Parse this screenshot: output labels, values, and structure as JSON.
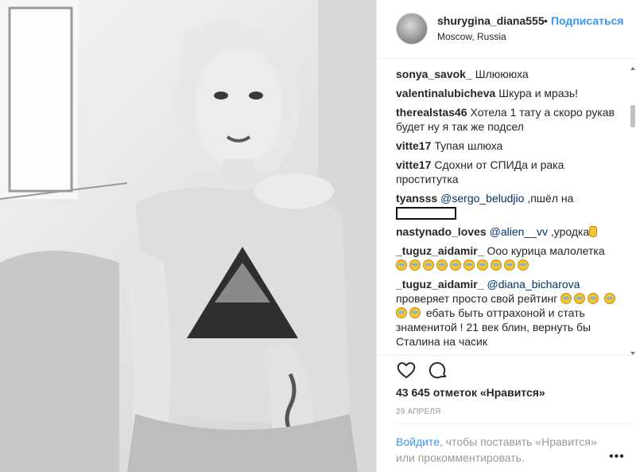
{
  "post": {
    "username": "shurygina_diana555",
    "separator": "•",
    "follow_label": "Подписаться",
    "location": "Moscow, Russia",
    "likes": "43 645 отметок «Нравится»",
    "date": "29 АПРЕЛЯ"
  },
  "comments": [
    {
      "user": "sonya_savok_",
      "text": "Шлюююха"
    },
    {
      "user": "valentinalubicheva",
      "text": "Шкура и мразь!"
    },
    {
      "user": "therealstas46",
      "text": "Хотела 1 тату а скоро рукав будет ну я так же подсел"
    },
    {
      "user": "vitte17",
      "text": "Тупая шлюха"
    },
    {
      "user": "vitte17",
      "text": "Сдохни от СПИДа и рака проститутка"
    },
    {
      "user": "tyansss",
      "mention": "@sergo_beludjio",
      "text": ",пшёл на"
    },
    {
      "user": "nastynado_loves",
      "mention": "@alien__vv",
      "text": ",уродка"
    },
    {
      "user": "_tuguz_aidamir_",
      "text": "Ооо курица малолетка"
    },
    {
      "user": "_tuguz_aidamir_",
      "mention": "@diana_bicharova",
      "text_a": "проверяет просто свой рейтинг",
      "text_b": "ебать быть оттрахоной и стать знаменитой ! 21 век блин, вернуть бы Сталина на часик"
    }
  ],
  "footer": {
    "login_link": "Войдите",
    "login_rest": ", чтобы поставить «Нравится» или прокомментировать.",
    "more_label": "•••"
  },
  "icons": {
    "like": "heart-outline-icon",
    "comment": "speech-bubble-icon",
    "emoji": "grimacing-face-emoji",
    "middle_finger": "middle-finger-emoji"
  },
  "colors": {
    "follow": "#3897f0",
    "mention": "#003569",
    "muted": "#999999",
    "text": "#262626"
  }
}
